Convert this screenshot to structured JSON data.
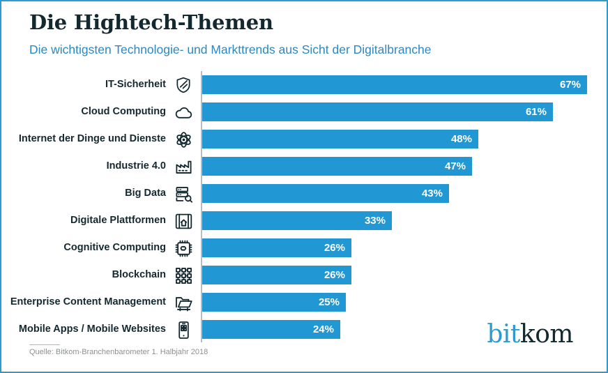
{
  "header": {
    "title": "Die Hightech-Themen",
    "subtitle": "Die wichtigsten Technologie- und Markttrends aus Sicht der Digitalbranche"
  },
  "footer": {
    "source": "Quelle: Bitkom-Branchenbarometer 1. Halbjahr 2018",
    "logo_part1": "bit",
    "logo_part2": "kom"
  },
  "colors": {
    "bar": "#2198d4",
    "accent": "#2e9ad0",
    "title": "#14282f",
    "subtitle": "#2e87bf",
    "axis": "#b9bcbe",
    "source": "#8c9093",
    "border": "#2e9ad0",
    "value_label": "#ffffff"
  },
  "chart_data": {
    "type": "bar",
    "orientation": "horizontal",
    "title": "Die Hightech-Themen",
    "subtitle": "Die wichtigsten Technologie- und Markttrends aus Sicht der Digitalbranche",
    "xlabel": "",
    "ylabel": "",
    "xlim": [
      0,
      67
    ],
    "grid": false,
    "legend": false,
    "unit": "%",
    "source": "Quelle: Bitkom-Branchenbarometer 1. Halbjahr 2018",
    "categories": [
      "IT-Sicherheit",
      "Cloud Computing",
      "Internet der Dinge und Dienste",
      "Industrie 4.0",
      "Big Data",
      "Digitale Plattformen",
      "Cognitive Computing",
      "Blockchain",
      "Enterprise Content Management",
      "Mobile Apps / Mobile Websites"
    ],
    "values": [
      67,
      61,
      48,
      47,
      43,
      33,
      26,
      26,
      25,
      24
    ],
    "value_labels": [
      "67%",
      "61%",
      "48%",
      "47%",
      "43%",
      "33%",
      "26%",
      "26%",
      "25%",
      "24%"
    ],
    "icons": [
      "shield-icon",
      "cloud-icon",
      "atom-network-icon",
      "factory-icon",
      "server-search-icon",
      "platform-home-icon",
      "cpu-brain-icon",
      "blockchain-grid-icon",
      "folder-icon",
      "mobile-phone-icon"
    ]
  }
}
